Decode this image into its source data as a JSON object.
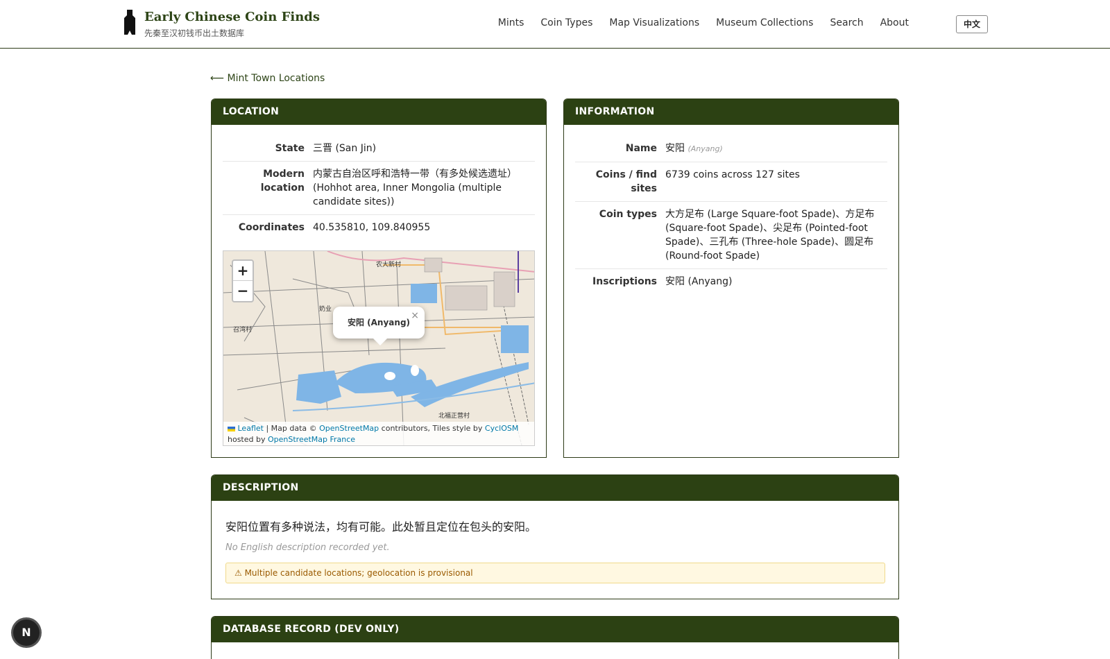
{
  "header": {
    "title": "Early Chinese Coin Finds",
    "subtitle": "先秦至汉初钱币出土数据库",
    "nav": [
      "Mints",
      "Coin Types",
      "Map Visualizations",
      "Museum Collections",
      "Search",
      "About"
    ],
    "lang_button": "中文"
  },
  "back_link": "⟵ Mint Town Locations",
  "location": {
    "heading": "LOCATION",
    "rows": [
      {
        "label": "State",
        "value": "三晋 (San Jin)"
      },
      {
        "label": "Modern location",
        "value": "内蒙古自治区呼和浩特一带（有多处候选遗址）(Hohhot area, Inner Mongolia (multiple candidate sites))"
      },
      {
        "label": "Coordinates",
        "value": "40.535810, 109.840955"
      }
    ],
    "map": {
      "zoom_in": "+",
      "zoom_out": "−",
      "popup": "安阳 (Anyang)",
      "popup_close": "×",
      "labels": [
        "农大新村",
        "奶业",
        "召湾村",
        "北福正营村"
      ],
      "attribution": {
        "leaflet": "Leaflet",
        "text1": " | Map data © ",
        "osm": "OpenStreetMap",
        "text2": " contributors, Tiles style by ",
        "cyclosm": "CyclOSM",
        "text3": "hosted by ",
        "osmfr": "OpenStreetMap France"
      }
    }
  },
  "information": {
    "heading": "INFORMATION",
    "name_label": "Name",
    "name_value": "安阳",
    "name_en": "(Anyang)",
    "rows": [
      {
        "label": "Coins / find sites",
        "value": "6739 coins across 127 sites"
      },
      {
        "label": "Coin types",
        "value": "大方足布 (Large Square-foot Spade)、方足布 (Square-foot Spade)、尖足布 (Pointed-foot Spade)、三孔布 (Three-hole Spade)、圆足布 (Round-foot Spade)"
      },
      {
        "label": "Inscriptions",
        "value": "安阳 (Anyang)"
      }
    ]
  },
  "description": {
    "heading": "DESCRIPTION",
    "zh": "安阳位置有多种说法，均有可能。此处暂且定位在包头的安阳。",
    "en": "No English description recorded yet.",
    "warning": "⚠ Multiple candidate locations; geolocation is provisional"
  },
  "db_record": {
    "heading": "DATABASE RECORD (DEV ONLY)"
  },
  "dev_badge": "N"
}
